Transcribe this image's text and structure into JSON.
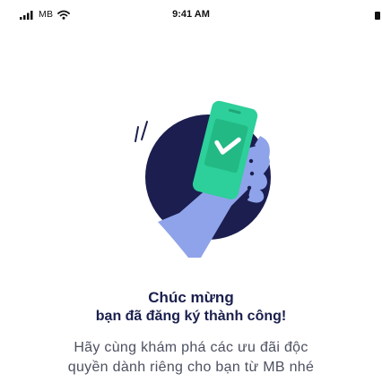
{
  "status_bar": {
    "carrier": "MB",
    "time": "9:41 AM"
  },
  "illustration": {
    "name": "phone-success-icon",
    "colors": {
      "circle": "#1b1e4e",
      "hand": "#8fa3ea",
      "phone": "#2dcf9a",
      "screen": "#22b985",
      "check": "#ffffff"
    }
  },
  "message": {
    "title_line1": "Chúc mừng",
    "title_line2": "bạn đã đăng ký thành công!",
    "description_line1": "Hãy cùng khám phá các ưu đãi độc",
    "description_line2": "quyền dành riêng cho bạn từ MB nhé"
  }
}
